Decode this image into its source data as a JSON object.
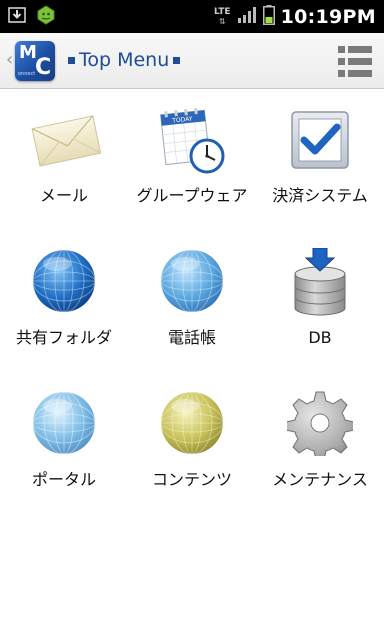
{
  "status_bar": {
    "time": "10:19PM",
    "network": "LTE",
    "icons": [
      "download-icon",
      "android-icon",
      "signal-icon",
      "battery-icon"
    ]
  },
  "action_bar": {
    "logo_letters_m": "M",
    "logo_letters_c": "C",
    "logo_sub1": "obile",
    "logo_sub2": "onnect",
    "title": "Top Menu"
  },
  "menu": {
    "items": [
      {
        "label": "メール",
        "icon": "mail-icon"
      },
      {
        "label": "グループウェア",
        "icon": "calendar-clock-icon"
      },
      {
        "label": "決済システム",
        "icon": "checkbox-icon"
      },
      {
        "label": "共有フォルダ",
        "icon": "globe-icon",
        "color": "#1f6fc5"
      },
      {
        "label": "電話帳",
        "icon": "globe-icon",
        "color": "#5aa8e0"
      },
      {
        "label": "DB",
        "icon": "database-icon"
      },
      {
        "label": "ポータル",
        "icon": "globe-icon",
        "color": "#7fbde6"
      },
      {
        "label": "コンテンツ",
        "icon": "globe-icon",
        "color": "#c9c25a"
      },
      {
        "label": "メンテナンス",
        "icon": "gear-icon"
      }
    ]
  },
  "calendar_text": "TODAY"
}
